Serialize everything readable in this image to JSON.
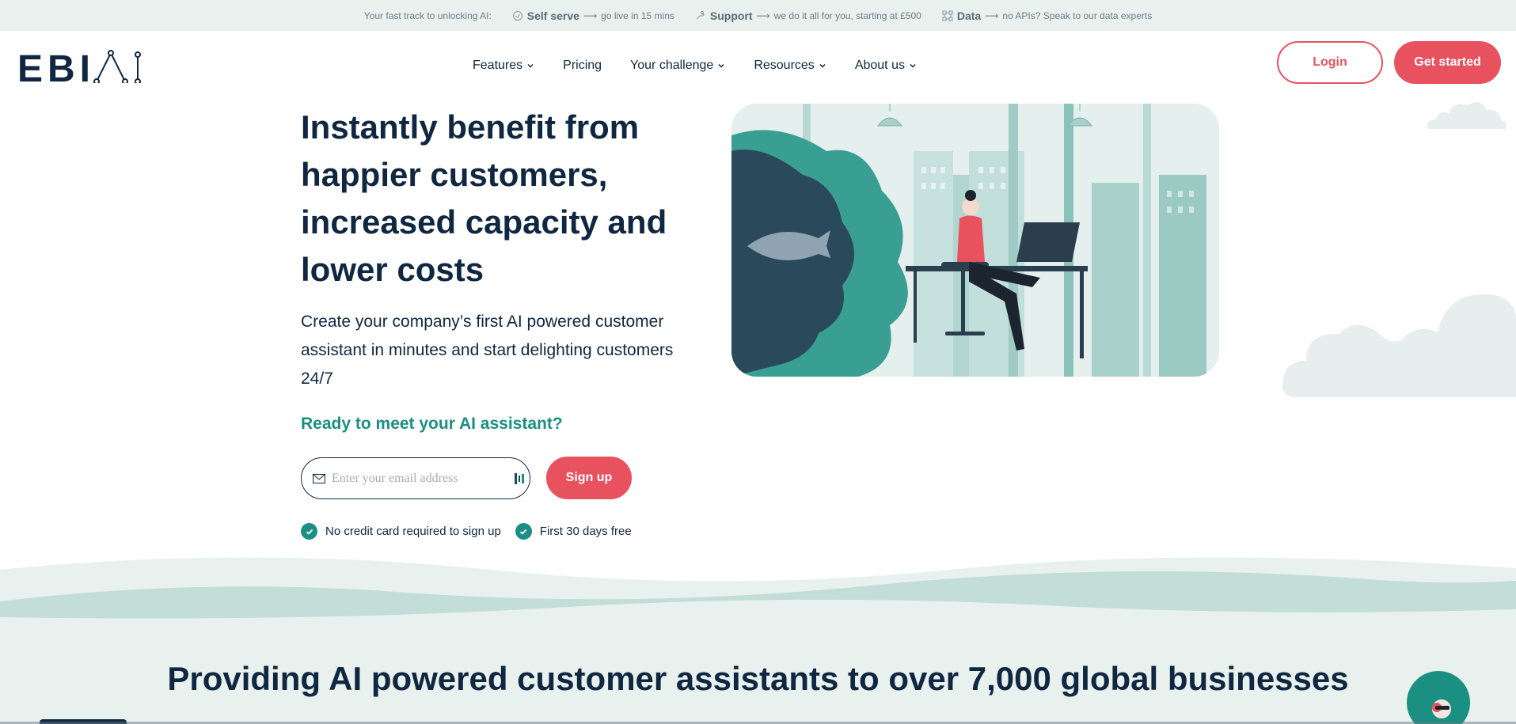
{
  "topbar": {
    "intro": "Your fast track to unlocking AI:",
    "items": [
      {
        "title": "Self serve",
        "arrow": "⟶",
        "desc": "go live in 15 mins",
        "icon": "check-circle-icon"
      },
      {
        "title": "Support",
        "arrow": "⟶",
        "desc": "we do it all for you, starting at £500",
        "icon": "hand-icon"
      },
      {
        "title": "Data",
        "arrow": "⟶",
        "desc": "no APIs? Speak to our data experts",
        "icon": "network-icon"
      }
    ]
  },
  "header": {
    "logo_text": "EBI.AI",
    "nav": [
      {
        "label": "Features",
        "dropdown": true
      },
      {
        "label": "Pricing",
        "dropdown": false
      },
      {
        "label": "Your challenge",
        "dropdown": true
      },
      {
        "label": "Resources",
        "dropdown": true
      },
      {
        "label": "About us",
        "dropdown": true
      }
    ],
    "login_label": "Login",
    "get_started_label": "Get started"
  },
  "hero": {
    "title": "Instantly benefit from happier customers, increased capacity and lower costs",
    "subtitle": "Create your company’s first AI powered customer assistant in minutes and start delighting customers 24/7",
    "ready": "Ready to meet your AI assistant?",
    "email_placeholder": "Enter your email address",
    "signup_label": "Sign up",
    "checks": [
      "No credit card required to sign up",
      "First 30 days free"
    ]
  },
  "section": {
    "title": "Providing AI powered customer assistants to over 7,000 global businesses"
  },
  "colors": {
    "navy": "#0f2740",
    "coral": "#e8525f",
    "teal": "#1a8f82",
    "mint_bg": "#e9f1ef"
  }
}
